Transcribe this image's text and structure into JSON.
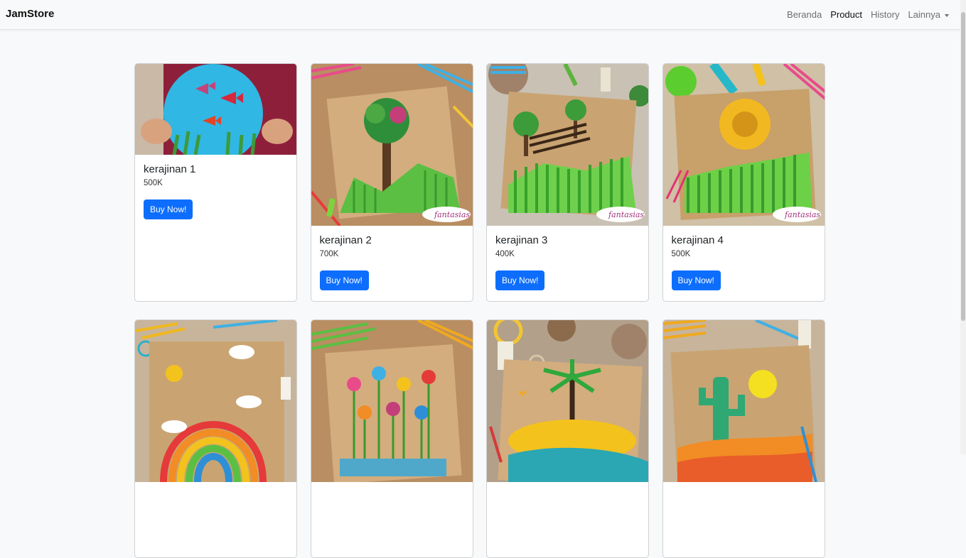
{
  "navbar": {
    "brand": "JamStore",
    "links": [
      "Beranda",
      "Product",
      "History"
    ],
    "dropdown_label": "Lainnya"
  },
  "products": [
    {
      "title": "kerajinan 1",
      "price": "500K",
      "button": "Buy Now!",
      "image": "paper-fish-aquarium"
    },
    {
      "title": "kerajinan 2",
      "price": "700K",
      "button": "Buy Now!",
      "image": "straw-tree-craft",
      "watermark": "fantasias"
    },
    {
      "title": "kerajinan 3",
      "price": "400K",
      "button": "Buy Now!",
      "image": "straw-bench-park",
      "watermark": "fantasias"
    },
    {
      "title": "kerajinan 4",
      "price": "500K",
      "button": "Buy Now!",
      "image": "straw-sunflower-field",
      "watermark": "fantasias"
    },
    {
      "title": "",
      "price": "",
      "button": "",
      "image": "straw-rainbow"
    },
    {
      "title": "",
      "price": "",
      "button": "",
      "image": "straw-flowers"
    },
    {
      "title": "",
      "price": "",
      "button": "",
      "image": "straw-palm-island"
    },
    {
      "title": "",
      "price": "",
      "button": "",
      "image": "straw-cactus-desert"
    }
  ],
  "colors": {
    "primary": "#0d6efd",
    "navbar_bg": "#f8f9fa",
    "page_bg": "#f8f9fa"
  }
}
